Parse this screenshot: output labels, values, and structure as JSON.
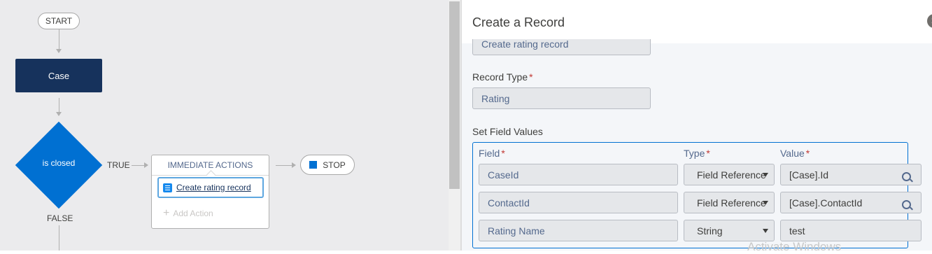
{
  "canvas": {
    "start_label": "START",
    "object_node_label": "Case",
    "criteria_node_label": "is closed",
    "true_label": "TRUE",
    "false_label": "FALSE",
    "immediate_actions_header": "IMMEDIATE ACTIONS",
    "action_item_label": "Create rating record",
    "add_action_label": "Add Action",
    "stop_label": "STOP"
  },
  "panel": {
    "title": "Create a Record",
    "action_name_value": "Create rating record",
    "record_type_label": "Record Type",
    "record_type_value": "Rating",
    "set_field_values_label": "Set Field Values",
    "columns": {
      "field": "Field",
      "type": "Type",
      "value": "Value"
    },
    "rows": [
      {
        "field": "CaseId",
        "type": "Field Reference",
        "value": "[Case].Id"
      },
      {
        "field": "ContactId",
        "type": "Field Reference",
        "value": "[Case].ContactId"
      },
      {
        "field": "Rating Name",
        "type": "String",
        "value": "test"
      }
    ]
  },
  "watermark": "Activate Windows",
  "colors": {
    "primary": "#0070d2",
    "navy": "#16325c",
    "required": "#c23934"
  },
  "icons": [
    "stop-square-icon",
    "action-list-icon",
    "plus-icon",
    "search-icon",
    "dropdown-arrow-icon",
    "close-icon"
  ]
}
